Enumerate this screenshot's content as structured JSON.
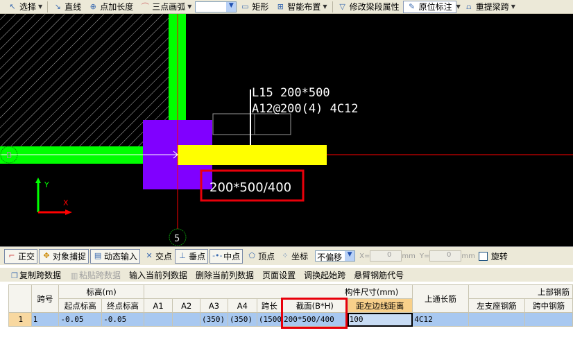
{
  "toolbar": {
    "select": "选择",
    "line": "直线",
    "point_length": "点加长度",
    "arc3": "三点画弧",
    "rect": "矩形",
    "smart_layout": "智能布置",
    "modify_props": "修改梁段属性",
    "in_place": "原位标注",
    "re_extract": "重提梁跨"
  },
  "canvas": {
    "beam_label_1": "L15 200*500",
    "beam_label_2": "A12@200(4) 4C12",
    "section_text": "200*500/400",
    "axis_bubble_h": "B",
    "axis_bubble_v": "5",
    "axis_y": "Y",
    "axis_x": "X",
    "colors": {
      "wall": "#00ff00",
      "column": "#8000ff",
      "beam": "#ffff00",
      "axis": "#ff0000",
      "highlight": "#e8000a"
    }
  },
  "snapbar": {
    "ortho": "正交",
    "osnap": "对象捕捉",
    "dyn_input": "动态输入",
    "intersect": "交点",
    "perp": "垂点",
    "mid": "中点",
    "vertex": "顶点",
    "coord": "坐标",
    "offset_mode": "不偏移",
    "x_label": "X=",
    "x_val": "0",
    "y_label": "Y=",
    "y_val": "0",
    "unit": "mm",
    "rotate": "旋转"
  },
  "grid_toolbar": {
    "copy": "复制跨数据",
    "paste": "粘贴跨数据",
    "input_col": "输入当前列数据",
    "delete_col": "删除当前列数据",
    "page_setup": "页面设置",
    "swap_start": "调换起始跨",
    "cantilever": "悬臂钢筋代号"
  },
  "table": {
    "group_headers": {
      "span_no": "跨号",
      "elevation": "标高(m)",
      "dims": "构件尺寸(mm)",
      "top_through": "上通长筋",
      "top_rebar": "上部钢筋"
    },
    "headers": {
      "start_elev": "起点标高",
      "end_elev": "终点标高",
      "a1": "A1",
      "a2": "A2",
      "a3": "A3",
      "a4": "A4",
      "span_len": "跨长",
      "section": "截面(B*H)",
      "dist_left": "距左边线距离",
      "left_support": "左支座钢筋",
      "mid_span": "跨中钢筋"
    },
    "rows": [
      {
        "row": "1",
        "span": "1",
        "start_elev": "-0.05",
        "end_elev": "-0.05",
        "a1": "",
        "a2": "",
        "a3": "(350)",
        "a4": "(350)",
        "span_len": "(1500",
        "section": "200*500/400",
        "dist_left": "100",
        "top_through": "4C12",
        "left_support": "",
        "mid_span": ""
      }
    ]
  }
}
